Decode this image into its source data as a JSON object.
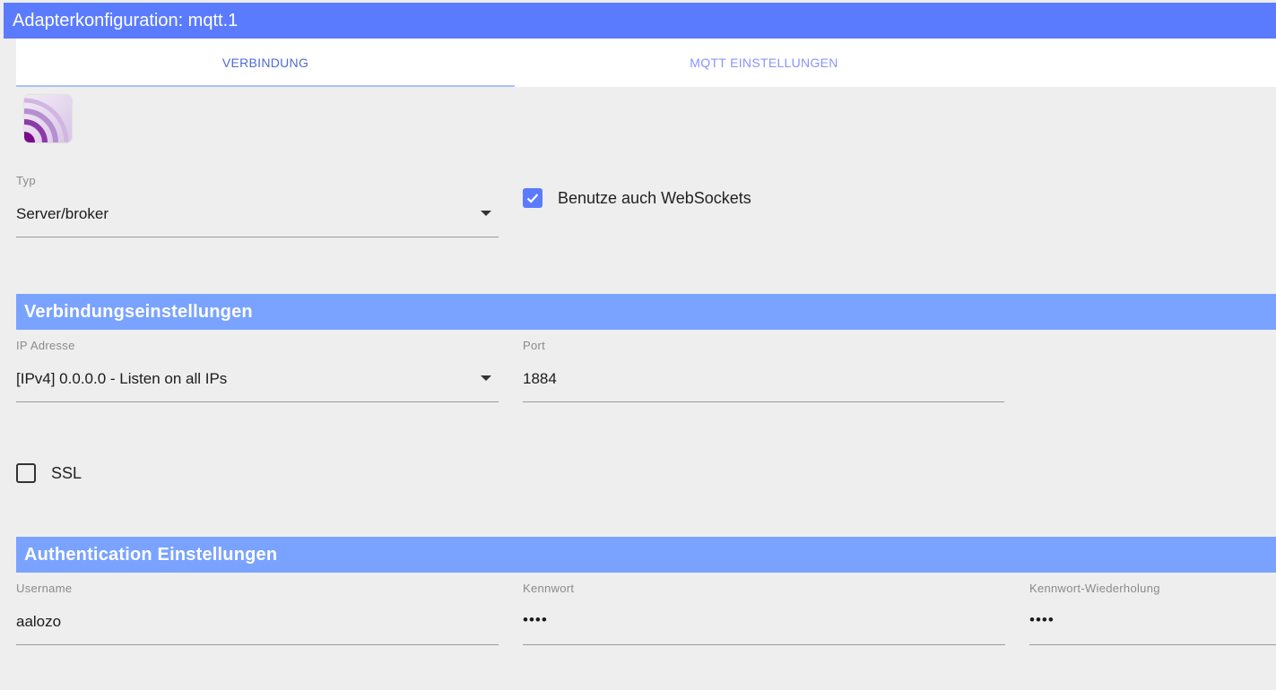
{
  "window": {
    "title": "Adapterkonfiguration: mqtt.1"
  },
  "tabs": [
    {
      "label": "VERBINDUNG",
      "active": true
    },
    {
      "label": "MQTT EINSTELLUNGEN",
      "active": false
    }
  ],
  "connection": {
    "type_label": "Typ",
    "type_value": "Server/broker",
    "websockets_label": "Benutze auch WebSockets",
    "websockets_checked": true
  },
  "sections": {
    "connection_settings": "Verbindungseinstellungen",
    "auth_settings": "Authentication Einstellungen"
  },
  "connection_settings": {
    "ip_label": "IP Adresse",
    "ip_value": "[IPv4] 0.0.0.0 - Listen on all IPs",
    "port_label": "Port",
    "port_value": "1884",
    "ssl_label": "SSL",
    "ssl_checked": false
  },
  "auth": {
    "username_label": "Username",
    "username_value": "aalozo",
    "password_label": "Kennwort",
    "password_value": "••••",
    "password_repeat_label": "Kennwort-Wiederholung",
    "password_repeat_value": "••••"
  },
  "colors": {
    "titlebar": "#5b7bff",
    "section_header": "#7aa3ff",
    "checkbox_checked": "#5b7bff",
    "background": "#eeeeee"
  }
}
